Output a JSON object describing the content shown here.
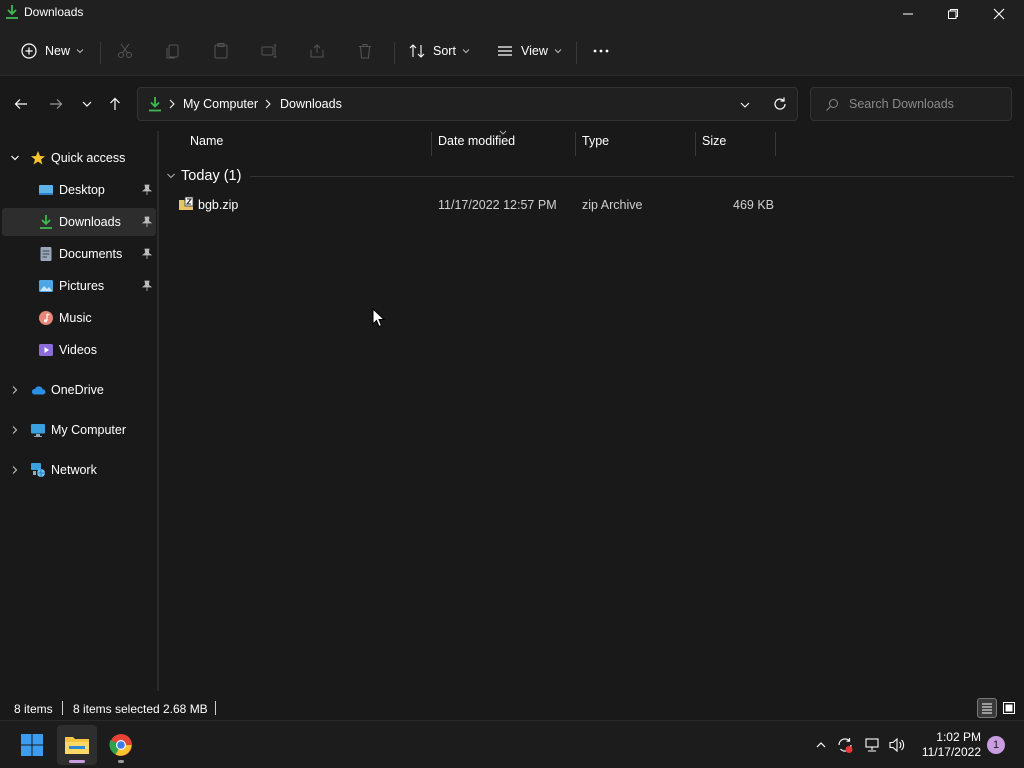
{
  "window": {
    "title": "Downloads",
    "buttons": {
      "minimize": "minimize",
      "maximize": "restore",
      "close": "close"
    }
  },
  "commandbar": {
    "new_label": "New",
    "sort_label": "Sort",
    "view_label": "View",
    "disabled_actions": [
      "cut",
      "copy",
      "paste",
      "rename",
      "share",
      "delete"
    ]
  },
  "address": {
    "crumbs": [
      "My Computer",
      "Downloads"
    ],
    "search_placeholder": "Search Downloads"
  },
  "sidebar": {
    "items": [
      {
        "label": "Quick access",
        "icon": "star-icon",
        "expanded": true
      },
      {
        "label": "Desktop",
        "icon": "desktop-icon",
        "pinned": true
      },
      {
        "label": "Downloads",
        "icon": "download-icon",
        "pinned": true,
        "selected": true
      },
      {
        "label": "Documents",
        "icon": "documents-icon",
        "pinned": true
      },
      {
        "label": "Pictures",
        "icon": "pictures-icon",
        "pinned": true
      },
      {
        "label": "Music",
        "icon": "music-icon"
      },
      {
        "label": "Videos",
        "icon": "videos-icon"
      },
      {
        "label": "OneDrive",
        "icon": "cloud-icon",
        "expanded": false
      },
      {
        "label": "My Computer",
        "icon": "computer-icon",
        "expanded": false
      },
      {
        "label": "Network",
        "icon": "network-icon",
        "expanded": false
      }
    ]
  },
  "content": {
    "columns": [
      "Name",
      "Date modified",
      "Type",
      "Size"
    ],
    "group": "Today (1)",
    "files": [
      {
        "name": "bgb.zip",
        "date_modified": "11/17/2022 12:57 PM",
        "type": "zip Archive",
        "size": "469 KB"
      }
    ]
  },
  "status": {
    "items_count": "8 items",
    "selection": "8 items selected",
    "selection_size": "2.68 MB"
  },
  "taskbar": {
    "time": "1:02 PM",
    "date": "11/17/2022",
    "notification_count": "1",
    "accent_color": "#c99de0"
  }
}
